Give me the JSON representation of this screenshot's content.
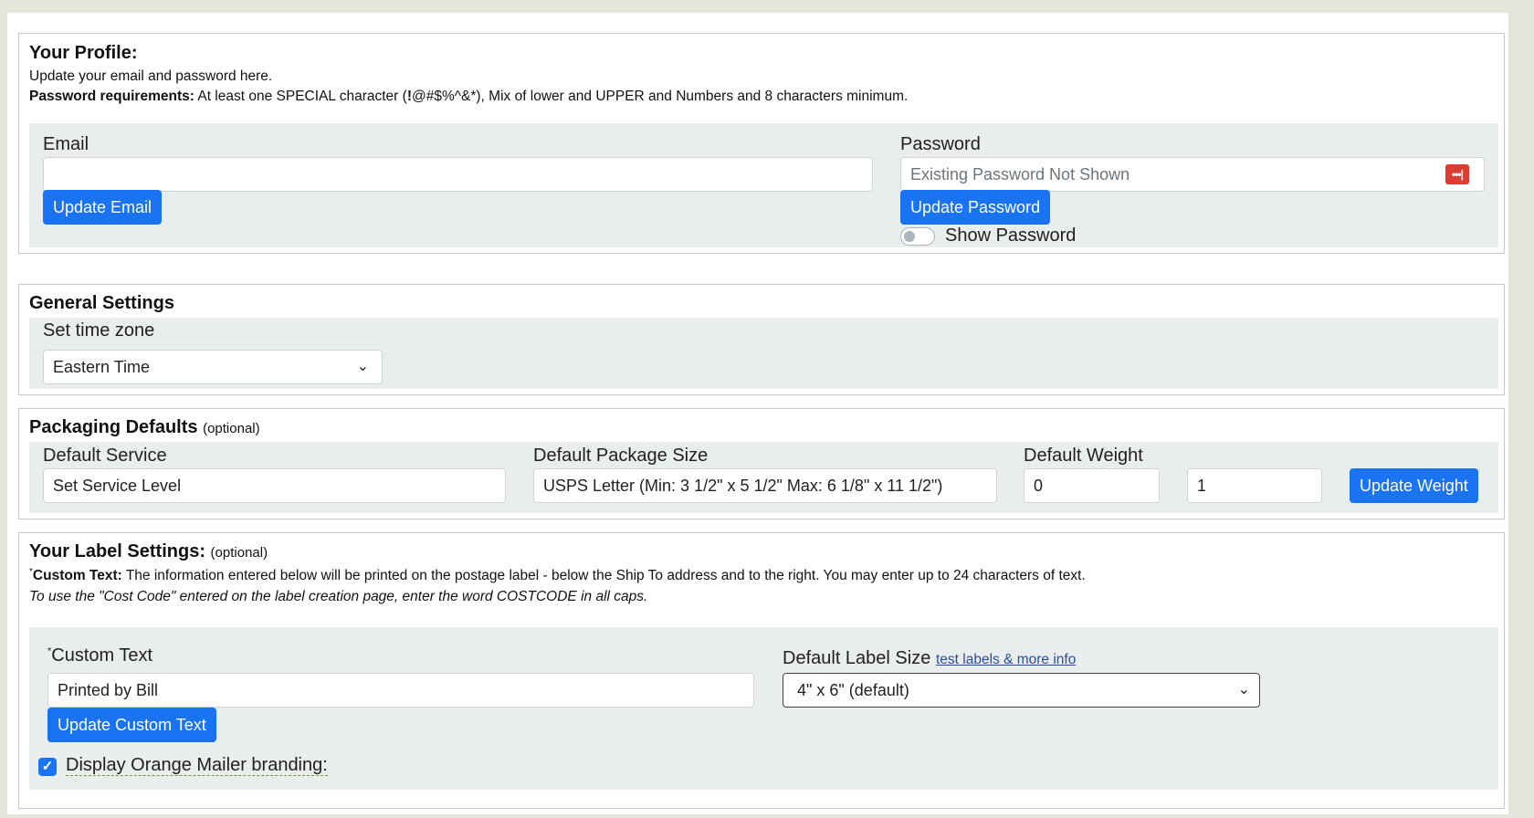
{
  "profile": {
    "heading": "Your Profile:",
    "intro": "Update your email and password here.",
    "requirements_label": "Password requirements:",
    "requirements_text": "At least one SPECIAL character (",
    "requirements_bang": "!",
    "requirements_text2": "@#$%^&*), Mix of lower and UPPER and Numbers and 8 characters minimum.",
    "email_label": "Email",
    "email_value": "",
    "update_email_button": "Update Email",
    "password_label": "Password",
    "password_placeholder": "Existing Password Not Shown",
    "update_password_button": "Update Password",
    "show_password_label": "Show Password",
    "show_password_on": false
  },
  "general": {
    "heading": "General Settings",
    "timezone_label": "Set time zone",
    "timezone_value": "Eastern Time"
  },
  "packaging": {
    "heading": "Packaging Defaults",
    "optional": "(optional)",
    "service_label": "Default Service",
    "service_value": "Set Service Level",
    "size_label": "Default Package Size",
    "size_value": "USPS Letter (Min: 3 1/2\" x 5 1/2\" Max: 6 1/8\" x 11 1/2\")",
    "weight_label": "Default Weight",
    "weight_value_1": "0",
    "weight_value_2": "1",
    "update_weight_button": "Update Weight"
  },
  "label": {
    "heading": "Your Label Settings:",
    "optional": "(optional)",
    "asterisk": "*",
    "custom_text_title": "Custom Text:",
    "custom_text_desc": "The information entered below will be printed on the postage label - below the Ship To address and to the right. You may enter up to 24 characters of text.",
    "costcode_note": "To use the \"Cost Code\" entered on the label creation page, enter the word COSTCODE in all caps.",
    "custom_text_label": "Custom Text",
    "custom_text_value": "Printed by Bill",
    "update_custom_text_button": "Update Custom Text",
    "label_size_label": "Default Label Size",
    "label_size_link": "test labels & more info",
    "label_size_value": "4\" x 6\" (default)",
    "branding_label": "Display Orange Mailer branding:",
    "branding_checked": true
  },
  "icons": {
    "password_manager": "password-dots-icon",
    "dropdown": "chevron-down-icon",
    "checkbox": "checkmark-icon"
  },
  "colors": {
    "primary_button": "#1a73f0",
    "panel_background": "#eaeded",
    "page_background": "#e4e6d9",
    "password_icon": "#dc3c33"
  }
}
